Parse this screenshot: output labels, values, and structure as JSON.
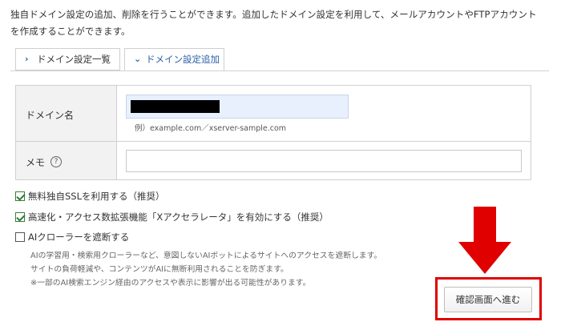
{
  "intro": {
    "line1": "独自ドメイン設定の追加、削除を行うことができます。追加したドメイン設定を利用して、メールアカウントやFTPアカウント",
    "line2": "を作成することができます。"
  },
  "tabs": [
    {
      "label": "ドメイン設定一覧",
      "icon": "chevron-right-icon",
      "active": false
    },
    {
      "label": "ドメイン設定追加",
      "icon": "chevron-down-icon",
      "active": true
    }
  ],
  "form": {
    "domain_label": "ドメイン名",
    "domain_example": "例）example.com／xserver-sample.com",
    "memo_label": "メモ",
    "help_icon": "?"
  },
  "options": [
    {
      "label": "無料独自SSLを利用する（推奨）",
      "checked": true
    },
    {
      "label": "高速化・アクセス数拡張機能「Xアクセラレータ」を有効にする（推奨）",
      "checked": true
    },
    {
      "label": "AIクローラーを遮断する",
      "checked": false
    }
  ],
  "notes": [
    "AIの学習用・検索用クローラーなど、意図しないAIボットによるサイトへのアクセスを遮断します。",
    "サイトの負荷軽減や、コンテンツがAIに無断利用されることを防ぎます。",
    "※一部のAI検索エンジン経由のアクセスや表示に影響が出る可能性があります。"
  ],
  "confirm_button": "確認画面へ進む",
  "colors": {
    "accent": "#2a5ea8",
    "highlight": "#e00000",
    "checkbox": "#2e7d32"
  }
}
